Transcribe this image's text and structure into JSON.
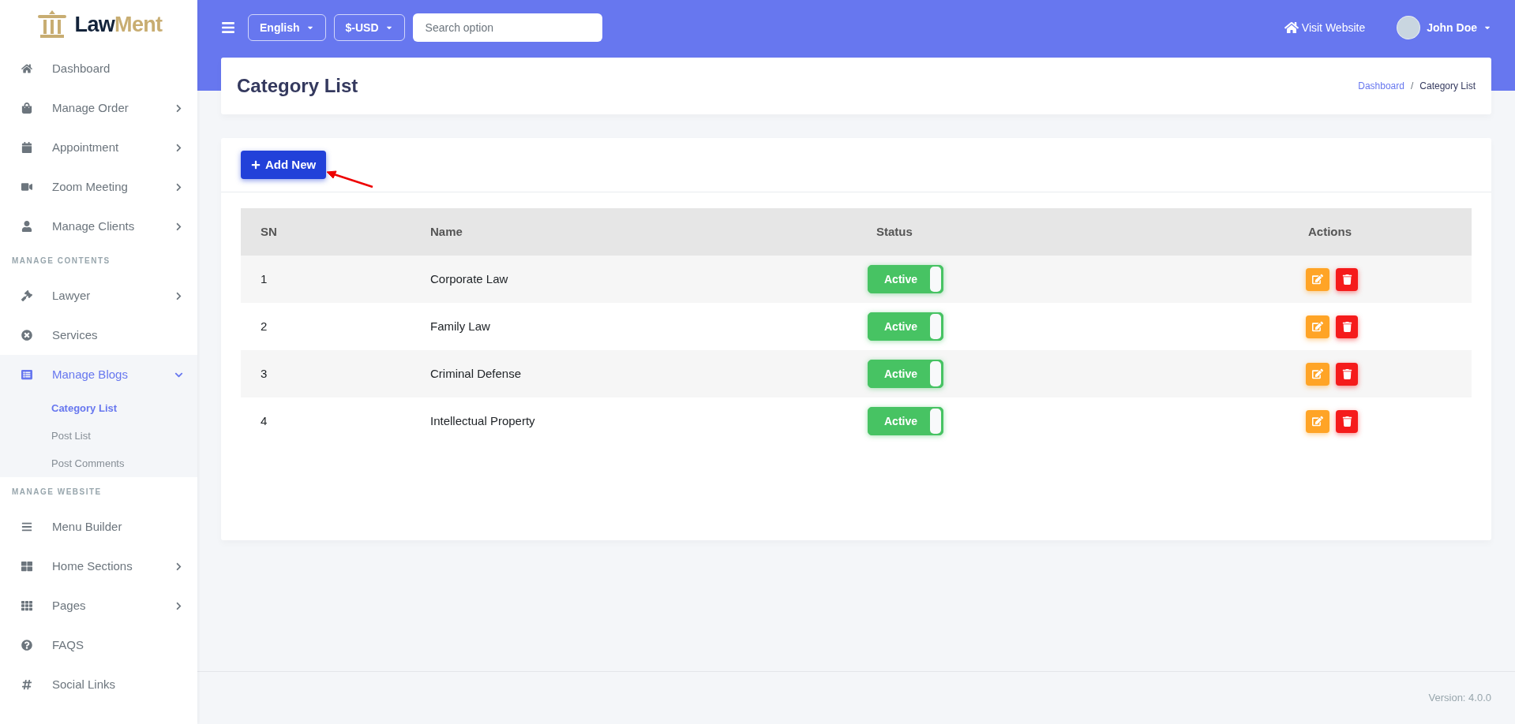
{
  "logo": [
    {
      "text": "Law",
      "color": "#13233a"
    },
    {
      "text": "Ment",
      "color": "#c8ad72"
    }
  ],
  "sidebar": {
    "sections": [
      {
        "items": [
          {
            "label": "Dashboard",
            "kind": "link",
            "expanded": false
          },
          {
            "label": "Manage Order",
            "kind": "menu",
            "expanded": false
          },
          {
            "label": "Appointment",
            "kind": "menu",
            "expanded": false
          },
          {
            "label": "Zoom Meeting",
            "kind": "menu",
            "expanded": false
          },
          {
            "label": "Manage Clients",
            "kind": "menu",
            "expanded": false
          }
        ]
      },
      {
        "heading": "MANAGE CONTENTS",
        "items": [
          {
            "label": "Lawyer",
            "kind": "menu",
            "expanded": false
          },
          {
            "label": "Services",
            "kind": "link",
            "expanded": false
          },
          {
            "label": "Manage Blogs",
            "kind": "menu",
            "expanded": true,
            "children": [
              {
                "label": "Category List",
                "selected": true
              },
              {
                "label": "Post List",
                "selected": false
              },
              {
                "label": "Post Comments",
                "selected": false
              }
            ]
          }
        ]
      },
      {
        "heading": "MANAGE WEBSITE",
        "items": [
          {
            "label": "Menu Builder",
            "kind": "link",
            "expanded": false
          },
          {
            "label": "Home Sections",
            "kind": "menu",
            "expanded": false
          },
          {
            "label": "Pages",
            "kind": "menu",
            "expanded": false
          },
          {
            "label": "FAQS",
            "kind": "link",
            "expanded": false
          },
          {
            "label": "Social Links",
            "kind": "link",
            "expanded": false
          }
        ]
      }
    ]
  },
  "topbar": {
    "language": "English",
    "currency": "$-USD",
    "search": {
      "placeholder": "Search option"
    },
    "visit_website": "Visit Website",
    "user": "John Doe"
  },
  "page": {
    "title": "Category List",
    "breadcrumb_separator": "/",
    "breadcrumb": [
      {
        "label": "Dashboard",
        "kind": "link"
      },
      {
        "label": "Category List",
        "kind": "current"
      }
    ]
  },
  "add_button": "Add New",
  "table": {
    "columns": [
      "SN",
      "Name",
      "Status",
      "Actions"
    ],
    "rows": [
      {
        "sn": "1",
        "name": "Corporate Law",
        "status": "Active",
        "on": true
      },
      {
        "sn": "2",
        "name": "Family Law",
        "status": "Active",
        "on": true
      },
      {
        "sn": "3",
        "name": "Criminal Defense",
        "status": "Active",
        "on": true
      },
      {
        "sn": "4",
        "name": "Intellectual Property",
        "status": "Active",
        "on": true
      }
    ]
  },
  "footer": {
    "version": "Version: 4.0.0"
  }
}
